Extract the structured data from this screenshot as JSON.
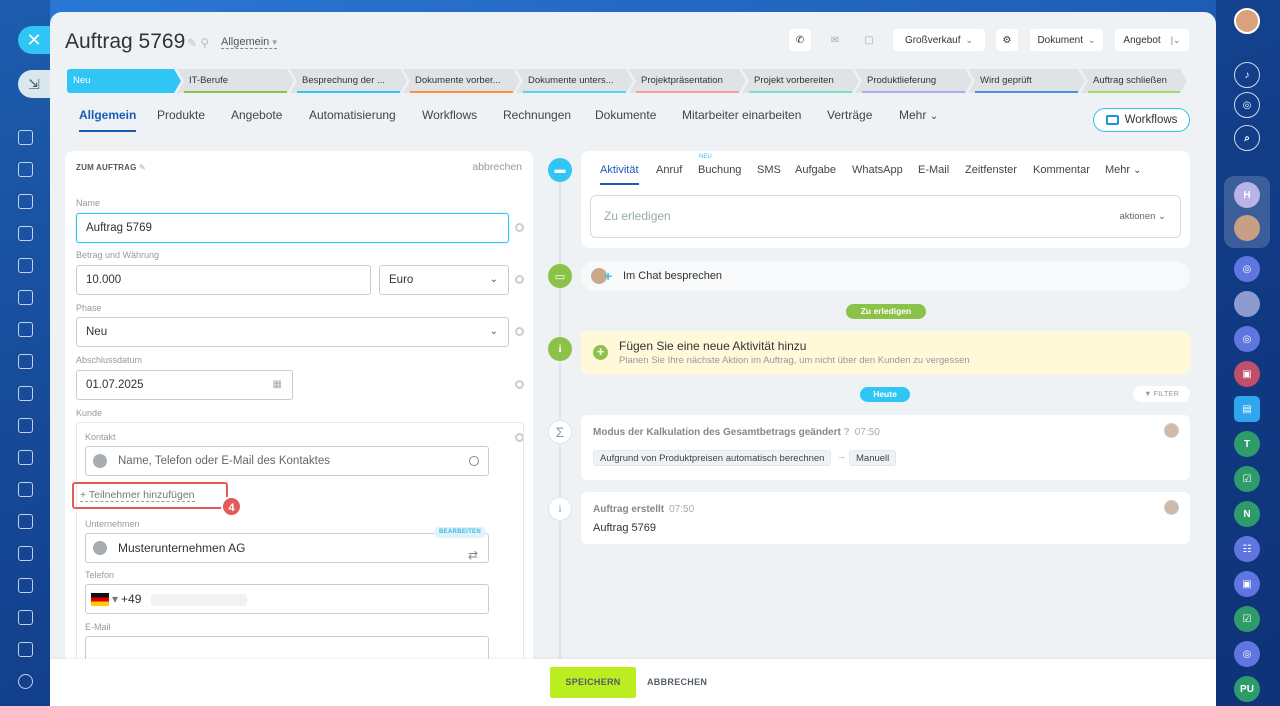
{
  "colors": {
    "accent": "#2fc6f6",
    "link": "#1b5bb6",
    "save": "#bbed21",
    "highlight": "#e35b58"
  },
  "window": {
    "close_icon": "close-icon",
    "minimize_icon": "minimize-icon"
  },
  "header": {
    "title": "Auftrag 5769",
    "category": "Allgemein",
    "buttons": {
      "channel": "Großverkauf",
      "document": "Dokument",
      "offer": "Angebot"
    }
  },
  "stages": [
    {
      "label": "Neu",
      "color": "#2fc6f6"
    },
    {
      "label": "IT-Berufe",
      "color": "#8bc34a"
    },
    {
      "label": "Besprechung der ...",
      "color": "#2fc6f6"
    },
    {
      "label": "Dokumente vorber...",
      "color": "#ff8f3c"
    },
    {
      "label": "Dokumente unters...",
      "color": "#5ad1f7"
    },
    {
      "label": "Projektpräsentation",
      "color": "#ff9d9d"
    },
    {
      "label": "Projekt vorbereiten",
      "color": "#7fdcd0"
    },
    {
      "label": "Produktlieferung",
      "color": "#b2a6f5"
    },
    {
      "label": "Wird geprüft",
      "color": "#4a90e2"
    },
    {
      "label": "Auftrag schließen",
      "color": "#a6d96a"
    }
  ],
  "tabs": [
    "Allgemein",
    "Produkte",
    "Angebote",
    "Automatisierung",
    "Workflows",
    "Rechnungen",
    "Dokumente",
    "Mitarbeiter einarbeiten",
    "Verträge",
    "Mehr"
  ],
  "workflows_button": "Workflows",
  "form": {
    "section_title": "ZUM AUFTRAG",
    "cancel": "abbrechen",
    "name_label": "Name",
    "name_value": "Auftrag 5769",
    "amount_label": "Betrag und Währung",
    "amount_value": "10.000",
    "currency_value": "Euro",
    "phase_label": "Phase",
    "phase_value": "Neu",
    "close_date_label": "Abschlussdatum",
    "close_date_value": "01.07.2025",
    "customer_label": "Kunde",
    "contact_label": "Kontakt",
    "contact_placeholder": "Name, Telefon oder E-Mail des Kontaktes",
    "add_participant": "+ Teilnehmer hinzufügen",
    "step_badge": "4",
    "company_label": "Unternehmen",
    "company_edit_badge": "BEARBEITEN",
    "company_value": "Musterunternehmen AG",
    "phone_label": "Telefon",
    "phone_value": "+49",
    "email_label": "E-Mail"
  },
  "activity": {
    "tabs": [
      "Aktivität",
      "Anruf",
      "Buchung",
      "SMS",
      "Aufgabe",
      "WhatsApp",
      "E-Mail",
      "Zeitfenster",
      "Kommentar",
      "Mehr"
    ],
    "new_tag": "NEU",
    "todo_placeholder": "Zu erledigen",
    "todo_actions": "aktionen",
    "chat_label": "Im Chat besprechen",
    "todo_pill": "Zu erledigen",
    "new_activity_title": "Fügen Sie eine neue Aktivität hinzu",
    "new_activity_sub": "Planen Sie Ihre nächste Aktion im Auftrag, um nicht über den Kunden zu vergessen",
    "today_pill": "Heute",
    "filter": "FILTER"
  },
  "events": [
    {
      "title": "Modus der Kalkulation des Gesamtbetrags geändert",
      "time": "07:50",
      "from": "Aufgrund von Produktpreisen automatisch berechnen",
      "to": "Manuell"
    },
    {
      "title": "Auftrag erstellt",
      "time": "07:50",
      "text": "Auftrag 5769"
    }
  ],
  "footer": {
    "save": "SPEICHERN",
    "cancel": "ABBRECHEN"
  },
  "right_rail": {
    "avatars": [
      "T",
      "N",
      "PU"
    ]
  }
}
